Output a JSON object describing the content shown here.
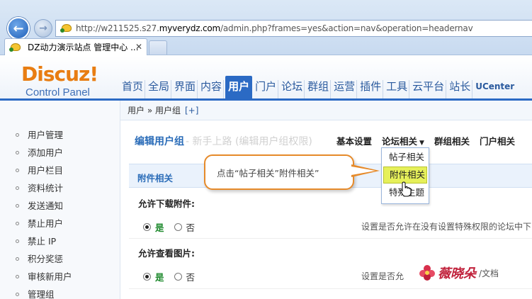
{
  "browser": {
    "url_prefix": "http://w211525.s27.",
    "url_domain": "myverydz.com",
    "url_suffix": "/admin.php?frames=yes&action=nav&operation=headernav",
    "tab_title": "DZ动力演示站点 管理中心 ...",
    "tab_close": "✕"
  },
  "logo": {
    "main": "Discuz!",
    "sub": "Control Panel"
  },
  "topnav": [
    "首页",
    "全局",
    "界面",
    "内容",
    "用户",
    "门户",
    "论坛",
    "群组",
    "运营",
    "插件",
    "工具",
    "云平台",
    "站长",
    "UCenter"
  ],
  "topnav_active": "用户",
  "breadcrumb": {
    "text": "用户 » 用户组",
    "plus": "[+]"
  },
  "sidebar": {
    "items": [
      "用户管理",
      "添加用户",
      "用户栏目",
      "资料统计",
      "发送通知",
      "禁止用户",
      "禁止 IP",
      "积分奖惩",
      "审核新用户",
      "管理组"
    ]
  },
  "main": {
    "title": "编辑用户组",
    "title_rest": "- 新手上路 (编辑用户组权限)",
    "subtabs": [
      "基本设置",
      "论坛相关",
      "群组相关",
      "门户相关"
    ],
    "dropdown_caret": "▼",
    "section_title": "附件相关",
    "settings": [
      {
        "label": "允许下载附件:",
        "yes": "是",
        "no": "否",
        "desc": "设置是否允许在没有设置特殊权限的论坛中下"
      },
      {
        "label": "允许查看图片:",
        "yes": "是",
        "no": "否",
        "desc": "设置是否允"
      }
    ]
  },
  "dropdown": {
    "items": [
      "帖子相关",
      "附件相关",
      "特殊主题"
    ],
    "highlighted": "附件相关"
  },
  "callout": {
    "text": "点击“帖子相关”附件相关”"
  },
  "watermark": {
    "text": "薇晓朵",
    "sub": "/文档"
  },
  "colors": {
    "accent": "#2b6ac4",
    "logo": "#e87d12",
    "highlight": "#e6f05a",
    "callout_border": "#e68a2a"
  }
}
